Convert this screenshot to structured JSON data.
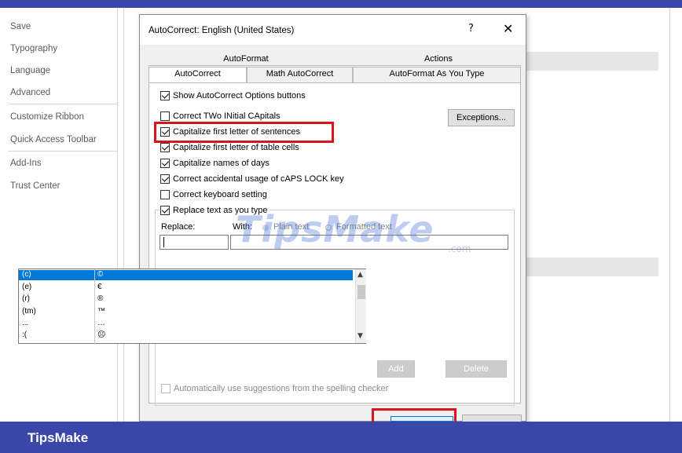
{
  "nav": {
    "items": [
      "Save",
      "Typography",
      "Language",
      "Advanced",
      "Customize Ribbon",
      "Quick Access Toolbar",
      "Add-Ins",
      "Trust Center"
    ]
  },
  "dialog": {
    "title": "AutoCorrect: English (United States)",
    "help": "?",
    "close": "✕",
    "tabs_row1": [
      "AutoFormat",
      "Actions"
    ],
    "tabs_row2": [
      "AutoCorrect",
      "Math AutoCorrect",
      "AutoFormat As You Type"
    ],
    "active_tab": "AutoCorrect",
    "show_options": {
      "label": "Show AutoCorrect Options buttons",
      "checked": true
    },
    "options": [
      {
        "label": "Correct TWo INitial CApitals",
        "checked": false
      },
      {
        "label": "Capitalize first letter of sentences",
        "checked": true
      },
      {
        "label": "Capitalize first letter of table cells",
        "checked": true
      },
      {
        "label": "Capitalize names of days",
        "checked": true
      },
      {
        "label": "Correct accidental usage of cAPS LOCK key",
        "checked": true
      },
      {
        "label": "Correct keyboard setting",
        "checked": false
      }
    ],
    "exceptions_label": "Exceptions...",
    "replace_text": {
      "label": "Replace text as you type",
      "checked": true
    },
    "replace_label": "Replace:",
    "with_label": "With:",
    "plain_text_label": "Plain text",
    "formatted_text_label": "Formatted text",
    "replace_value": "",
    "with_value": "",
    "entries": [
      {
        "replace": "(c)",
        "with": "©",
        "selected": true
      },
      {
        "replace": "(e)",
        "with": "€",
        "selected": false
      },
      {
        "replace": "(r)",
        "with": "®",
        "selected": false
      },
      {
        "replace": "(tm)",
        "with": "™",
        "selected": false
      },
      {
        "replace": "...",
        "with": "…",
        "selected": false
      },
      {
        "replace": ":(",
        "with": "☹",
        "selected": false
      }
    ],
    "add_label": "Add",
    "delete_label": "Delete",
    "suggestions": {
      "label": "Automatically use suggestions from the spelling checker",
      "checked": false,
      "disabled": true
    }
  },
  "watermark": {
    "main": "TipsMake",
    "suffix": ".com"
  },
  "brand": "TipsMake",
  "colors": {
    "banner": "#3a47a8",
    "highlight": "#d8141e",
    "selection": "#0078d7"
  }
}
